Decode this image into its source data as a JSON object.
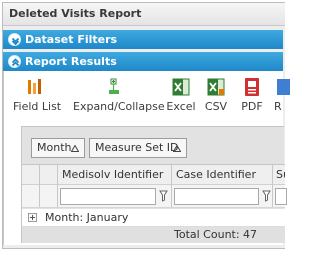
{
  "report": {
    "title": "Deleted Visits Report"
  },
  "sections": {
    "dataset_filters": "Dataset Filters",
    "report_results": "Report Results"
  },
  "toolbar": {
    "field_list": "Field List",
    "expand_collapse": "Expand/Collapse",
    "excel": "Excel",
    "csv": "CSV",
    "pdf": "PDF",
    "r": "R"
  },
  "grouping": {
    "chips": [
      "Month",
      "Measure Set ID"
    ]
  },
  "grid": {
    "columns": [
      "Medisolv Identifier",
      "Case Identifier",
      "Su"
    ],
    "filters": {
      "medisolv": "",
      "case": "",
      "su": ""
    },
    "group_label": "Month: January",
    "total_label": "Total Count: 47"
  },
  "colors": {
    "section_bar": "#1e88c9",
    "excel_green": "#2e7d32",
    "pdf_red": "#d32f2f",
    "field_list_orange": "#e07b00"
  }
}
